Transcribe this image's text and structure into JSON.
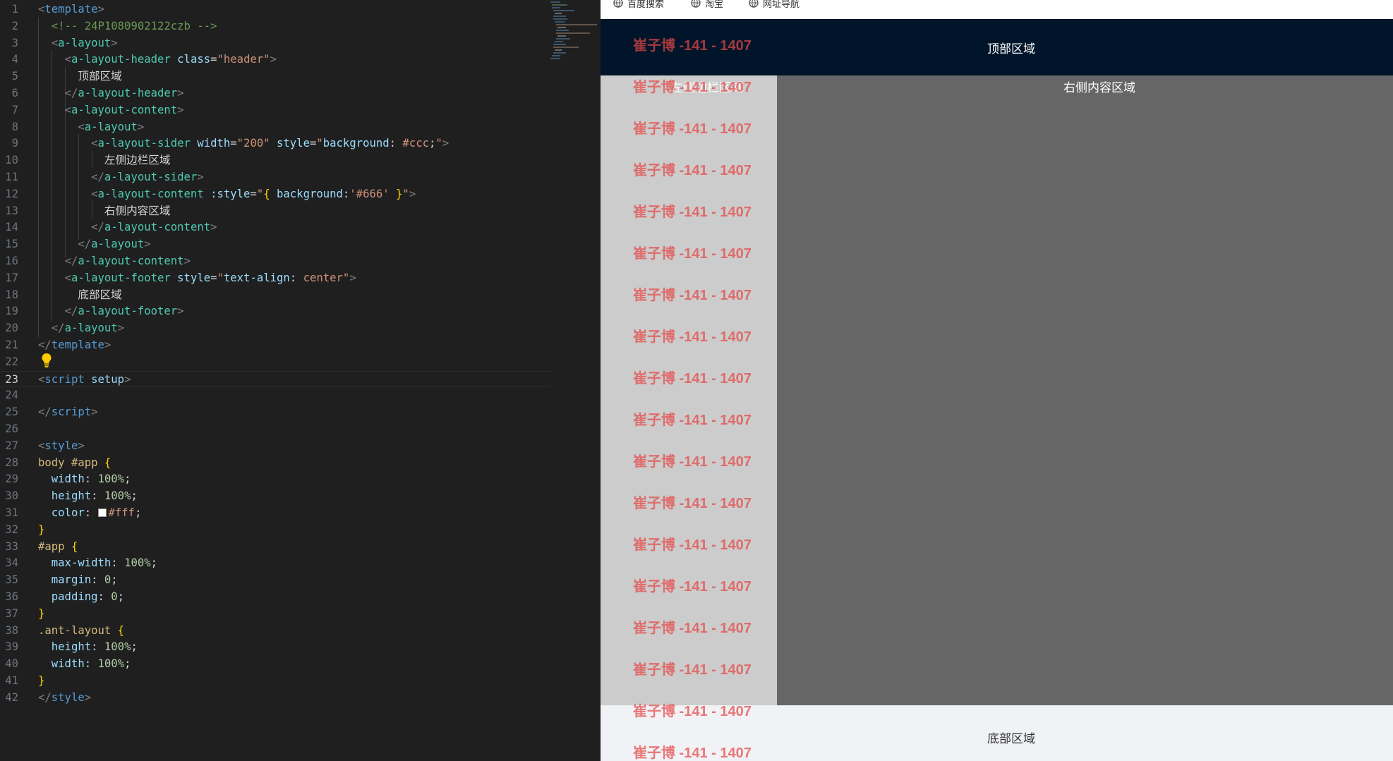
{
  "editor": {
    "lines": [
      {
        "n": "1",
        "tokens": [
          [
            "punct",
            "<"
          ],
          [
            "tag",
            "template"
          ],
          [
            "punct",
            ">"
          ]
        ]
      },
      {
        "n": "2",
        "tokens": [
          [
            "plain",
            "  "
          ],
          [
            "comment",
            "<!-- 24P1080902122czb -->"
          ]
        ]
      },
      {
        "n": "3",
        "tokens": [
          [
            "plain",
            "  "
          ],
          [
            "punct",
            "<"
          ],
          [
            "comp",
            "a-layout"
          ],
          [
            "punct",
            ">"
          ]
        ]
      },
      {
        "n": "4",
        "tokens": [
          [
            "plain",
            "    "
          ],
          [
            "punct",
            "<"
          ],
          [
            "comp",
            "a-layout-header"
          ],
          [
            "plain",
            " "
          ],
          [
            "attr",
            "class"
          ],
          [
            "plain",
            "="
          ],
          [
            "str",
            "\"header\""
          ],
          [
            "punct",
            ">"
          ]
        ]
      },
      {
        "n": "5",
        "tokens": [
          [
            "plain",
            "      "
          ],
          [
            "text",
            "顶部区域"
          ]
        ]
      },
      {
        "n": "6",
        "tokens": [
          [
            "plain",
            "    "
          ],
          [
            "punct",
            "</"
          ],
          [
            "comp",
            "a-layout-header"
          ],
          [
            "punct",
            ">"
          ]
        ]
      },
      {
        "n": "7",
        "tokens": [
          [
            "plain",
            "    "
          ],
          [
            "punct",
            "<"
          ],
          [
            "comp",
            "a-layout-content"
          ],
          [
            "punct",
            ">"
          ]
        ]
      },
      {
        "n": "8",
        "tokens": [
          [
            "plain",
            "      "
          ],
          [
            "punct",
            "<"
          ],
          [
            "comp",
            "a-layout"
          ],
          [
            "punct",
            ">"
          ]
        ]
      },
      {
        "n": "9",
        "tokens": [
          [
            "plain",
            "        "
          ],
          [
            "punct",
            "<"
          ],
          [
            "comp",
            "a-layout-sider"
          ],
          [
            "plain",
            " "
          ],
          [
            "attr",
            "width"
          ],
          [
            "plain",
            "="
          ],
          [
            "str",
            "\"200\""
          ],
          [
            "plain",
            " "
          ],
          [
            "attr",
            "style"
          ],
          [
            "plain",
            "="
          ],
          [
            "str",
            "\""
          ],
          [
            "prop",
            "background"
          ],
          [
            "plain",
            ": "
          ],
          [
            "str",
            "#ccc"
          ],
          [
            "plain",
            ";"
          ],
          [
            "str",
            "\""
          ],
          [
            "punct",
            ">"
          ]
        ]
      },
      {
        "n": "10",
        "tokens": [
          [
            "plain",
            "          "
          ],
          [
            "text",
            "左侧边栏区域"
          ]
        ]
      },
      {
        "n": "11",
        "tokens": [
          [
            "plain",
            "        "
          ],
          [
            "punct",
            "</"
          ],
          [
            "comp",
            "a-layout-sider"
          ],
          [
            "punct",
            ">"
          ]
        ]
      },
      {
        "n": "12",
        "tokens": [
          [
            "plain",
            "        "
          ],
          [
            "punct",
            "<"
          ],
          [
            "comp",
            "a-layout-content"
          ],
          [
            "plain",
            " "
          ],
          [
            "attr",
            ":style"
          ],
          [
            "plain",
            "="
          ],
          [
            "str",
            "\""
          ],
          [
            "brace",
            "{"
          ],
          [
            "plain",
            " "
          ],
          [
            "prop",
            "background"
          ],
          [
            "plain",
            ":"
          ],
          [
            "str",
            "'#666'"
          ],
          [
            "plain",
            " "
          ],
          [
            "brace",
            "}"
          ],
          [
            "str",
            "\""
          ],
          [
            "punct",
            ">"
          ]
        ]
      },
      {
        "n": "13",
        "tokens": [
          [
            "plain",
            "          "
          ],
          [
            "text",
            "右侧内容区域"
          ]
        ]
      },
      {
        "n": "14",
        "tokens": [
          [
            "plain",
            "        "
          ],
          [
            "punct",
            "</"
          ],
          [
            "comp",
            "a-layout-content"
          ],
          [
            "punct",
            ">"
          ]
        ]
      },
      {
        "n": "15",
        "tokens": [
          [
            "plain",
            "      "
          ],
          [
            "punct",
            "</"
          ],
          [
            "comp",
            "a-layout"
          ],
          [
            "punct",
            ">"
          ]
        ]
      },
      {
        "n": "16",
        "tokens": [
          [
            "plain",
            "    "
          ],
          [
            "punct",
            "</"
          ],
          [
            "comp",
            "a-layout-content"
          ],
          [
            "punct",
            ">"
          ]
        ]
      },
      {
        "n": "17",
        "tokens": [
          [
            "plain",
            "    "
          ],
          [
            "punct",
            "<"
          ],
          [
            "comp",
            "a-layout-footer"
          ],
          [
            "plain",
            " "
          ],
          [
            "attr",
            "style"
          ],
          [
            "plain",
            "="
          ],
          [
            "str",
            "\""
          ],
          [
            "prop",
            "text-align"
          ],
          [
            "plain",
            ": "
          ],
          [
            "str",
            "center"
          ],
          [
            "str",
            "\""
          ],
          [
            "punct",
            ">"
          ]
        ]
      },
      {
        "n": "18",
        "tokens": [
          [
            "plain",
            "      "
          ],
          [
            "text",
            "底部区域"
          ]
        ]
      },
      {
        "n": "19",
        "tokens": [
          [
            "plain",
            "    "
          ],
          [
            "punct",
            "</"
          ],
          [
            "comp",
            "a-layout-footer"
          ],
          [
            "punct",
            ">"
          ]
        ]
      },
      {
        "n": "20",
        "tokens": [
          [
            "plain",
            "  "
          ],
          [
            "punct",
            "</"
          ],
          [
            "comp",
            "a-layout"
          ],
          [
            "punct",
            ">"
          ]
        ]
      },
      {
        "n": "21",
        "tokens": [
          [
            "punct",
            "</"
          ],
          [
            "tag",
            "template"
          ],
          [
            "punct",
            ">"
          ]
        ]
      },
      {
        "n": "22",
        "tokens": []
      },
      {
        "n": "23",
        "tokens": [
          [
            "punct",
            "<"
          ],
          [
            "tag",
            "script"
          ],
          [
            "plain",
            " "
          ],
          [
            "attr",
            "setup"
          ],
          [
            "punct",
            ">"
          ]
        ]
      },
      {
        "n": "24",
        "tokens": []
      },
      {
        "n": "25",
        "tokens": [
          [
            "punct",
            "</"
          ],
          [
            "tag",
            "script"
          ],
          [
            "punct",
            ">"
          ]
        ]
      },
      {
        "n": "26",
        "tokens": []
      },
      {
        "n": "27",
        "tokens": [
          [
            "punct",
            "<"
          ],
          [
            "tag",
            "style"
          ],
          [
            "punct",
            ">"
          ]
        ]
      },
      {
        "n": "28",
        "tokens": [
          [
            "sel",
            "body #app"
          ],
          [
            "plain",
            " "
          ],
          [
            "brace",
            "{"
          ]
        ]
      },
      {
        "n": "29",
        "tokens": [
          [
            "plain",
            "  "
          ],
          [
            "prop",
            "width"
          ],
          [
            "plain",
            ": "
          ],
          [
            "num",
            "100%"
          ],
          [
            "plain",
            ";"
          ]
        ]
      },
      {
        "n": "30",
        "tokens": [
          [
            "plain",
            "  "
          ],
          [
            "prop",
            "height"
          ],
          [
            "plain",
            ": "
          ],
          [
            "num",
            "100%"
          ],
          [
            "plain",
            ";"
          ]
        ]
      },
      {
        "n": "31",
        "tokens": [
          [
            "plain",
            "  "
          ],
          [
            "prop",
            "color"
          ],
          [
            "plain",
            ": "
          ],
          [
            "swatch",
            ""
          ],
          [
            "str",
            "#fff"
          ],
          [
            "plain",
            ";"
          ]
        ]
      },
      {
        "n": "32",
        "tokens": [
          [
            "brace",
            "}"
          ]
        ]
      },
      {
        "n": "33",
        "tokens": [
          [
            "sel",
            "#app"
          ],
          [
            "plain",
            " "
          ],
          [
            "brace",
            "{"
          ]
        ]
      },
      {
        "n": "34",
        "tokens": [
          [
            "plain",
            "  "
          ],
          [
            "prop",
            "max-width"
          ],
          [
            "plain",
            ": "
          ],
          [
            "num",
            "100%"
          ],
          [
            "plain",
            ";"
          ]
        ]
      },
      {
        "n": "35",
        "tokens": [
          [
            "plain",
            "  "
          ],
          [
            "prop",
            "margin"
          ],
          [
            "plain",
            ": "
          ],
          [
            "num",
            "0"
          ],
          [
            "plain",
            ";"
          ]
        ]
      },
      {
        "n": "36",
        "tokens": [
          [
            "plain",
            "  "
          ],
          [
            "prop",
            "padding"
          ],
          [
            "plain",
            ": "
          ],
          [
            "num",
            "0"
          ],
          [
            "plain",
            ";"
          ]
        ]
      },
      {
        "n": "37",
        "tokens": [
          [
            "brace",
            "}"
          ]
        ]
      },
      {
        "n": "38",
        "tokens": [
          [
            "sel",
            ".ant-layout"
          ],
          [
            "plain",
            " "
          ],
          [
            "brace",
            "{"
          ]
        ]
      },
      {
        "n": "39",
        "tokens": [
          [
            "plain",
            "  "
          ],
          [
            "prop",
            "height"
          ],
          [
            "plain",
            ": "
          ],
          [
            "num",
            "100%"
          ],
          [
            "plain",
            ";"
          ]
        ]
      },
      {
        "n": "40",
        "tokens": [
          [
            "plain",
            "  "
          ],
          [
            "prop",
            "width"
          ],
          [
            "plain",
            ": "
          ],
          [
            "num",
            "100%"
          ],
          [
            "plain",
            ";"
          ]
        ]
      },
      {
        "n": "41",
        "tokens": [
          [
            "brace",
            "}"
          ]
        ]
      },
      {
        "n": "42",
        "tokens": [
          [
            "punct",
            "</"
          ],
          [
            "tag",
            "style"
          ],
          [
            "punct",
            ">"
          ]
        ]
      }
    ],
    "current_line": "23",
    "icons": {
      "lightbulb": "lightbulb-icon"
    },
    "colors": {
      "background": "#1f1f1f",
      "tag": "#569cd6",
      "component": "#4ec9b0",
      "attribute": "#9cdcfe",
      "string": "#ce9178",
      "comment": "#6a9955",
      "number": "#b5cea8",
      "brace": "#ffd700",
      "selector": "#d7ba7d"
    }
  },
  "browser": {
    "bookmarks": [
      {
        "label": "百度搜索",
        "icon": "globe-icon"
      },
      {
        "label": "淘宝",
        "icon": "globe-icon"
      },
      {
        "label": "网址导航",
        "icon": "globe-icon"
      }
    ]
  },
  "preview": {
    "header_text": "顶部区域",
    "sider_text": "左侧边栏区域",
    "content_text": "右侧内容区域",
    "footer_text": "底部区域",
    "colors": {
      "header_bg": "#001529",
      "sider_bg": "#cccccc",
      "content_bg": "#666666",
      "footer_bg": "#f0f2f5",
      "watermark": "#e64646"
    }
  },
  "watermark": {
    "text": "崔子博 -141 - 1407",
    "count": 18
  }
}
